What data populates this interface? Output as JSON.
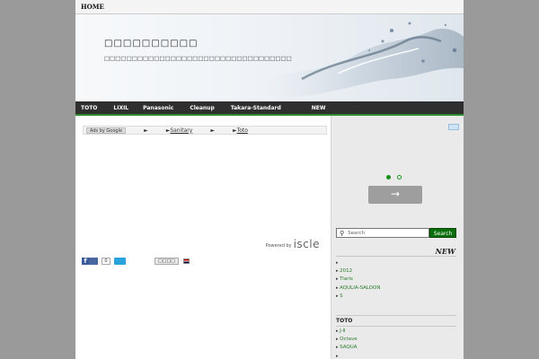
{
  "topnav": {
    "home": "HOME"
  },
  "header": {
    "title": "□□□□□□□□□□",
    "description": "□□□□□□□□□□□□□□□□□□□□□□□□□□□□□□□□□□"
  },
  "nav": {
    "items": [
      "TOTO",
      "LIXIL",
      "Panasonic",
      "Cleanup",
      "Takara-Standard",
      "NEW"
    ]
  },
  "ad": {
    "adsby": "Ads by Google",
    "arrow": "►",
    "links": [
      "Sanitary",
      "Toto"
    ]
  },
  "powered": {
    "by": "Powered by",
    "brand": "iscle"
  },
  "share": {
    "fb": "f",
    "count": "0",
    "check": "□□□□"
  },
  "sidebar": {
    "next": "→",
    "search_placeholder": "Search",
    "search_button": "Search",
    "new_heading": "NEW",
    "new_items": [
      "",
      "2012",
      "Tiaris",
      "AQULIA-SALOON",
      "S"
    ],
    "toto_heading": "TOTO",
    "toto_items": [
      "J-Ⅱ",
      "Octave",
      "SAQUA",
      ""
    ]
  }
}
